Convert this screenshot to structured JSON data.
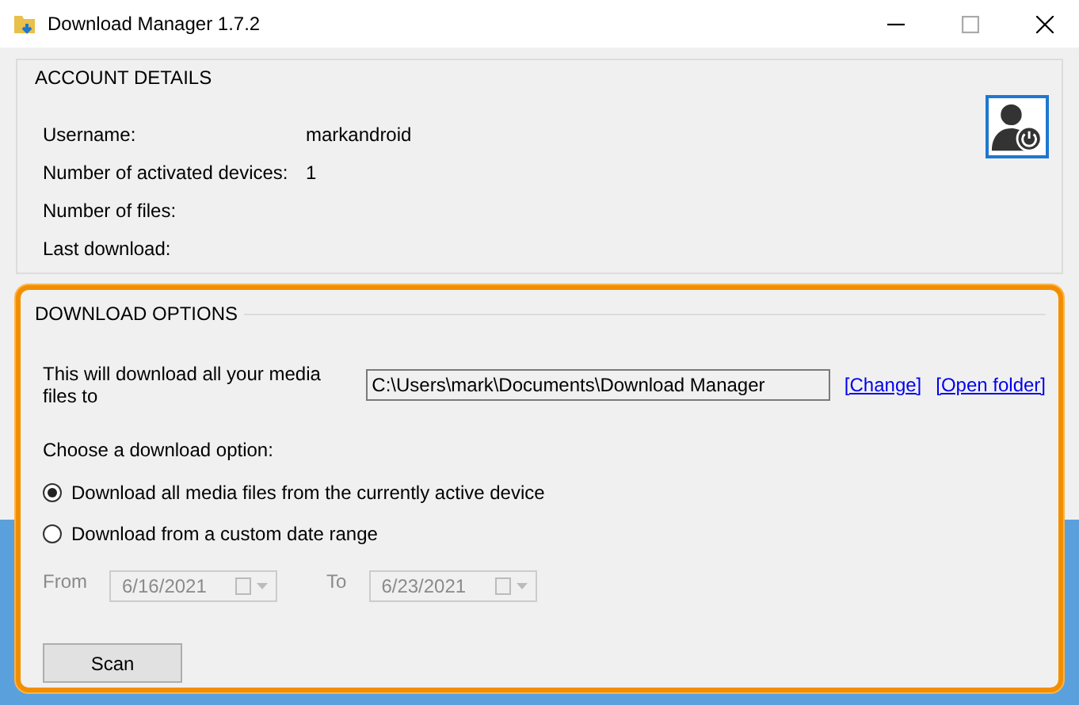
{
  "window": {
    "title": "Download Manager 1.7.2"
  },
  "account": {
    "title": "ACCOUNT DETAILS",
    "fields": [
      {
        "label": "Username:",
        "value": "markandroid"
      },
      {
        "label": "Number of activated devices:",
        "value": "1"
      },
      {
        "label": "Number of files:"
      },
      {
        "label": "Last download:"
      }
    ]
  },
  "download_options": {
    "title": "DOWNLOAD OPTIONS",
    "highlighted": true,
    "path_label": "This will download all your media files to",
    "path": "C:\\Users\\mark\\Documents\\Download Manager",
    "links": [
      "[Change]",
      "[Open folder]"
    ],
    "choose_label": "Choose a download option:",
    "options": [
      {
        "label": "Download all media files from the currently active device",
        "selected": true
      },
      {
        "label": "Download from a custom date range",
        "selected": false
      }
    ],
    "dates": [
      {
        "label": "From",
        "value": "6/16/2021",
        "disabled": true
      },
      {
        "label": "To",
        "value": "6/23/2021",
        "disabled": true
      }
    ],
    "button": "Scan"
  }
}
